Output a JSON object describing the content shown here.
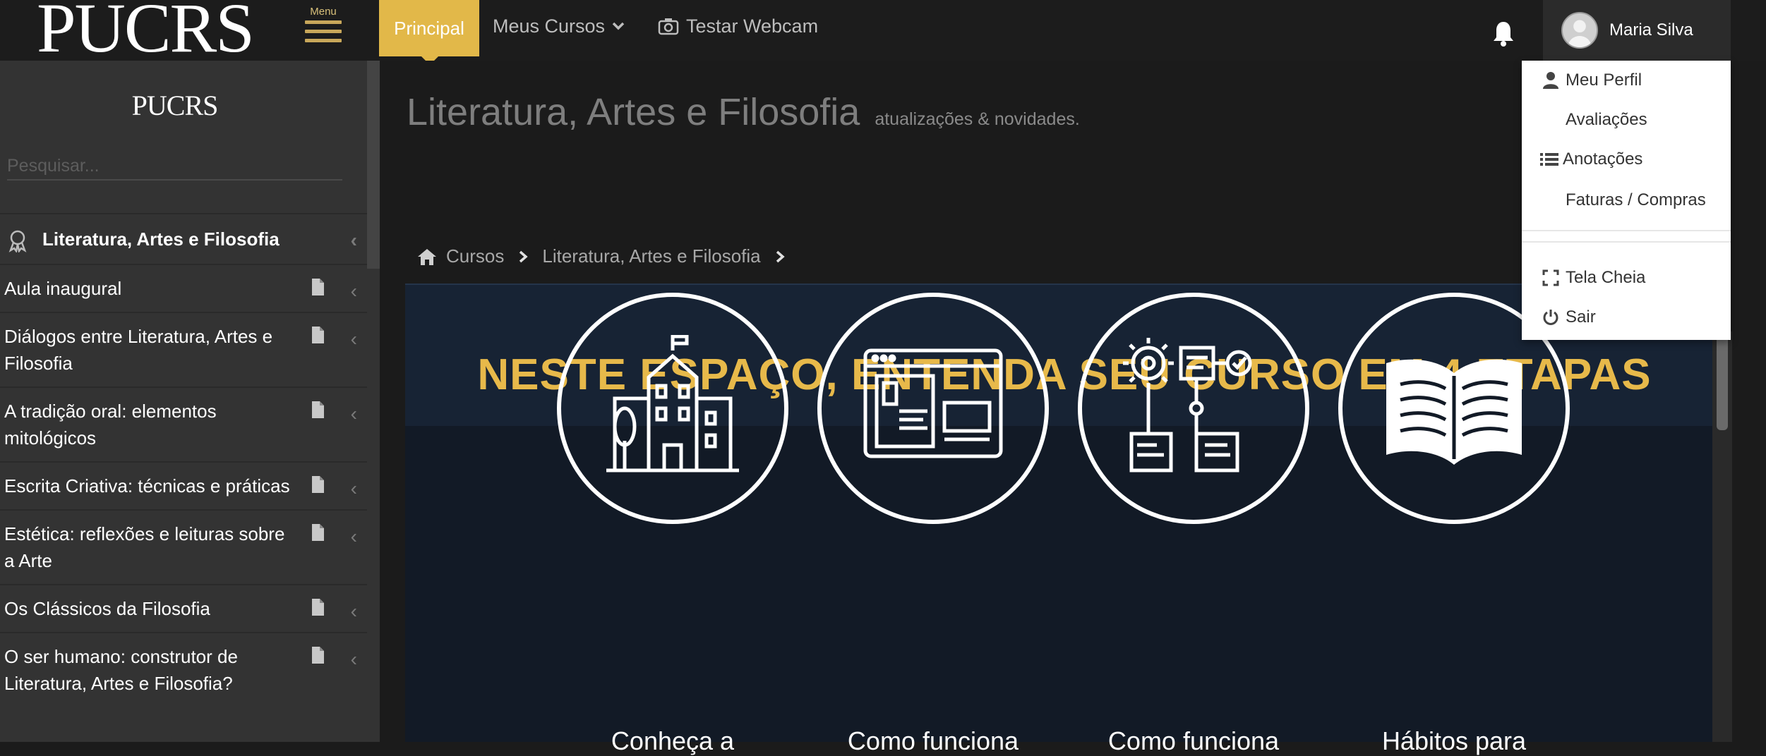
{
  "topbar": {
    "logo": "PUCRS",
    "menu_label": "Menu",
    "nav": {
      "principal": "Principal",
      "meus_cursos": "Meus Cursos",
      "testar_webcam": "Testar Webcam"
    },
    "user_name": "Maria Silva",
    "accent_color": "#e2b849"
  },
  "sidebar": {
    "logo": "PUCRS",
    "search_placeholder": "Pesquisar...",
    "course_title": "Literatura, Artes e Filosofia",
    "items": [
      {
        "label": "Aula inaugural"
      },
      {
        "label": "Diálogos entre Literatura, Artes e Filosofia"
      },
      {
        "label": "A tradição oral: elementos mitológicos"
      },
      {
        "label": "Escrita Criativa: técnicas e práticas"
      },
      {
        "label": "Estética: reflexões e leituras sobre a Arte"
      },
      {
        "label": "Os Clássicos da Filosofia"
      },
      {
        "label": "O ser humano: construtor de Literatura, Artes e Filosofia?"
      }
    ]
  },
  "main": {
    "title": "Literatura, Artes e Filosofia",
    "subtitle": "atualizações & novidades.",
    "breadcrumb": [
      "Cursos",
      "Literatura, Artes e Filosofia"
    ],
    "panel_title": "NESTE ESPAÇO, ENTENDA SEU CURSO EM 4 ETAPAS",
    "steps": [
      {
        "icon": "building-icon",
        "label": "Conheça a"
      },
      {
        "icon": "browser-window-icon",
        "label": "Como funciona"
      },
      {
        "icon": "workflow-gear-icon",
        "label": "Como funciona"
      },
      {
        "icon": "open-book-icon",
        "label": "Hábitos para"
      }
    ],
    "panel_title_color": "#e7b94a"
  },
  "dropdown": {
    "items": [
      {
        "label": "Meu Perfil",
        "icon": "user-icon"
      },
      {
        "label": "Avaliações",
        "icon": ""
      },
      {
        "label": "Anotações",
        "icon": "list-icon"
      },
      {
        "label": "Faturas / Compras",
        "icon": ""
      },
      {
        "label": "Tela Cheia",
        "icon": "fullscreen-icon"
      },
      {
        "label": "Sair",
        "icon": "power-icon"
      }
    ]
  }
}
